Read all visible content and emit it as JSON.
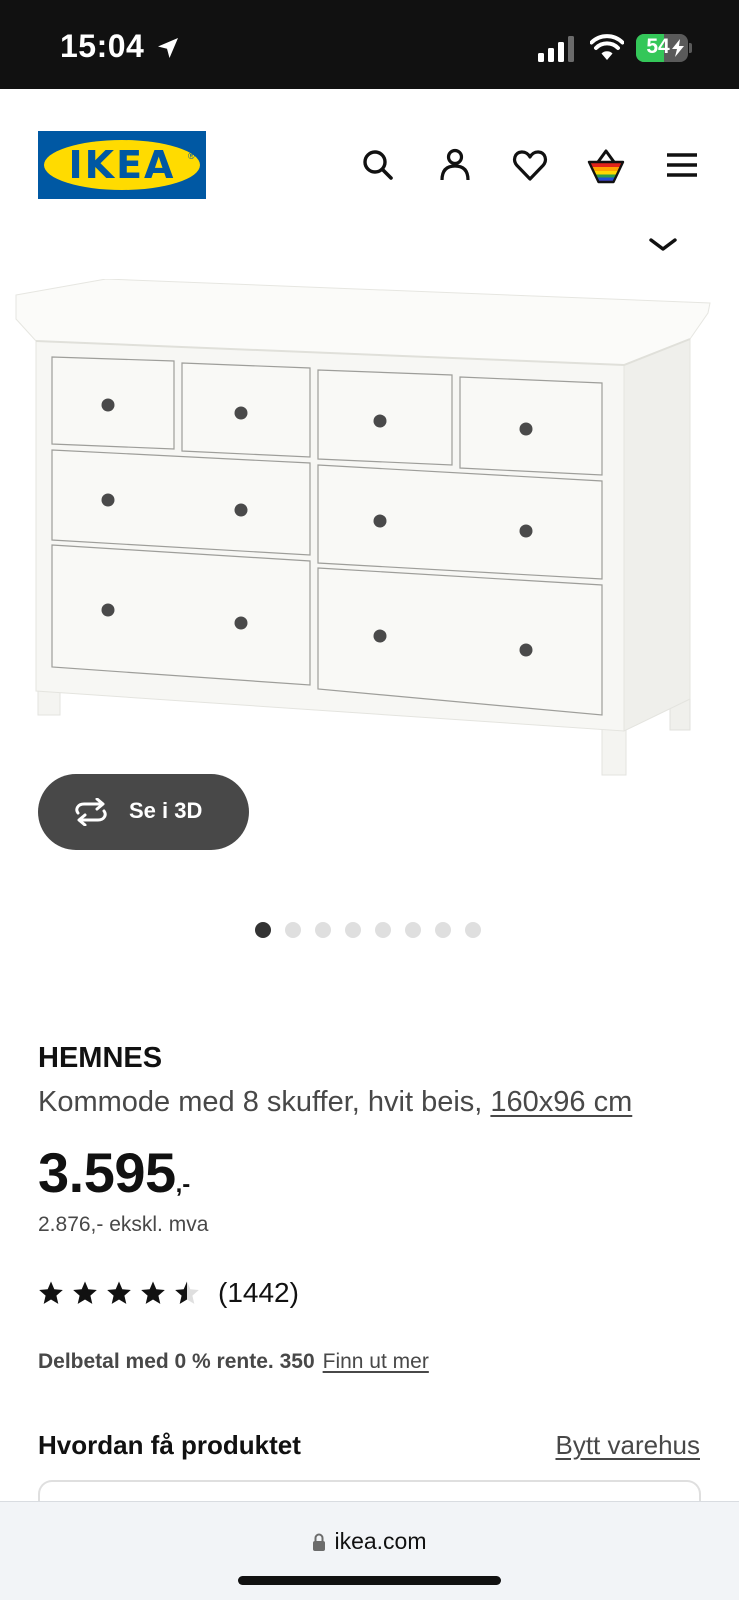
{
  "status_bar": {
    "time": "15:04",
    "battery_percent": 54,
    "battery_label": "54",
    "charging": true
  },
  "header": {
    "logo_text": "IKEA",
    "icons": [
      "search-icon",
      "profile-icon",
      "heart-icon",
      "shopping-bag-icon",
      "menu-icon"
    ]
  },
  "gallery": {
    "view_3d_label": "Se i 3D",
    "image_count": 8,
    "active_index": 0
  },
  "product": {
    "name": "HEMNES",
    "description": "Kommode med 8 skuffer, hvit beis, ",
    "dimensions": "160x96 cm",
    "price_integer": "3.595",
    "price_suffix": ",-",
    "price_ex_vat": "2.876,- ekskl. mva",
    "rating": 4.5,
    "rating_max": 5,
    "rating_count": "(1442)",
    "financing_text": "Delbetal med 0 % rente. 350",
    "financing_link": "Finn ut mer"
  },
  "delivery": {
    "title": "Hvordan få produktet",
    "change_store": "Bytt varehus"
  },
  "browser": {
    "url": "ikea.com"
  },
  "colors": {
    "brand_blue": "#0058a3",
    "brand_yellow": "#ffdb00",
    "text_dark": "#111111",
    "text_muted": "#484848",
    "battery_green": "#34c759"
  }
}
